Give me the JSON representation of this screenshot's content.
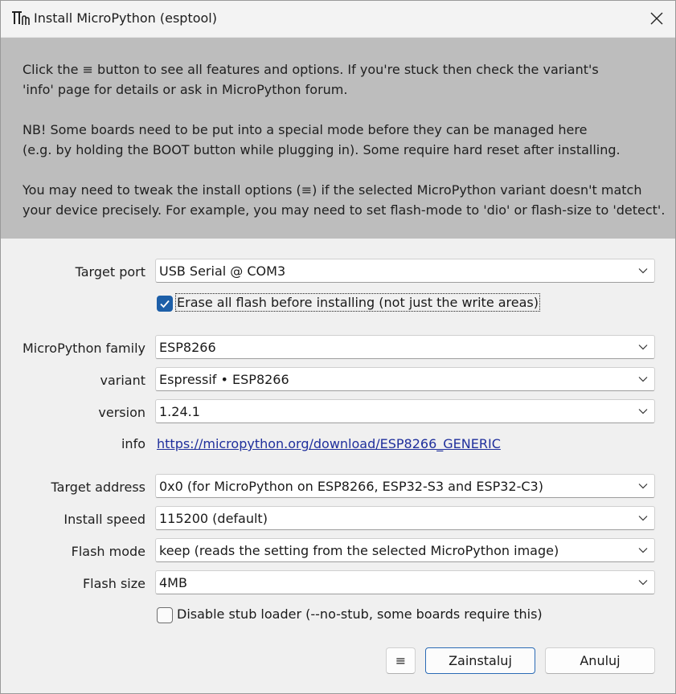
{
  "window": {
    "title": "Install MicroPython (esptool)"
  },
  "info": {
    "paragraph1": "Click the ≡ button to see all features and options. If you're stuck then check the variant's\n'info' page for details or ask in MicroPython forum.",
    "paragraph2": "NB! Some boards need to be put into a special mode before they can be managed here\n(e.g. by holding the BOOT button while plugging in). Some require hard reset after installing.",
    "paragraph3": "You may need to tweak the install options (≡) if the selected MicroPython variant doesn't match\nyour device precisely. For example, you may need to set flash-mode to 'dio' or flash-size to 'detect'."
  },
  "form": {
    "target_port": {
      "label": "Target port",
      "value": "USB Serial @ COM3"
    },
    "erase_flash": {
      "label": "Erase all flash before installing (not just the write areas)",
      "checked": true
    },
    "family": {
      "label": "MicroPython family",
      "value": "ESP8266"
    },
    "variant": {
      "label": "variant",
      "value": "Espressif • ESP8266"
    },
    "version": {
      "label": "version",
      "value": "1.24.1"
    },
    "info": {
      "label": "info",
      "link": "https://micropython.org/download/ESP8266_GENERIC"
    },
    "target_address": {
      "label": "Target address",
      "value": "0x0 (for MicroPython on ESP8266, ESP32-S3 and ESP32-C3)"
    },
    "install_speed": {
      "label": "Install speed",
      "value": "115200 (default)"
    },
    "flash_mode": {
      "label": "Flash mode",
      "value": "keep (reads the setting from the selected MicroPython image)"
    },
    "flash_size": {
      "label": "Flash size",
      "value": "4MB"
    },
    "disable_stub": {
      "label": "Disable stub loader (--no-stub, some boards require this)",
      "checked": false
    }
  },
  "buttons": {
    "menu": "≡",
    "install": "Zainstaluj",
    "cancel": "Anuluj"
  },
  "colors": {
    "banner_bg": "#bdbdbd",
    "checkbox_accent": "#1d5fa8",
    "link": "#1f2f9c",
    "primary_border": "#2b6bb5"
  }
}
